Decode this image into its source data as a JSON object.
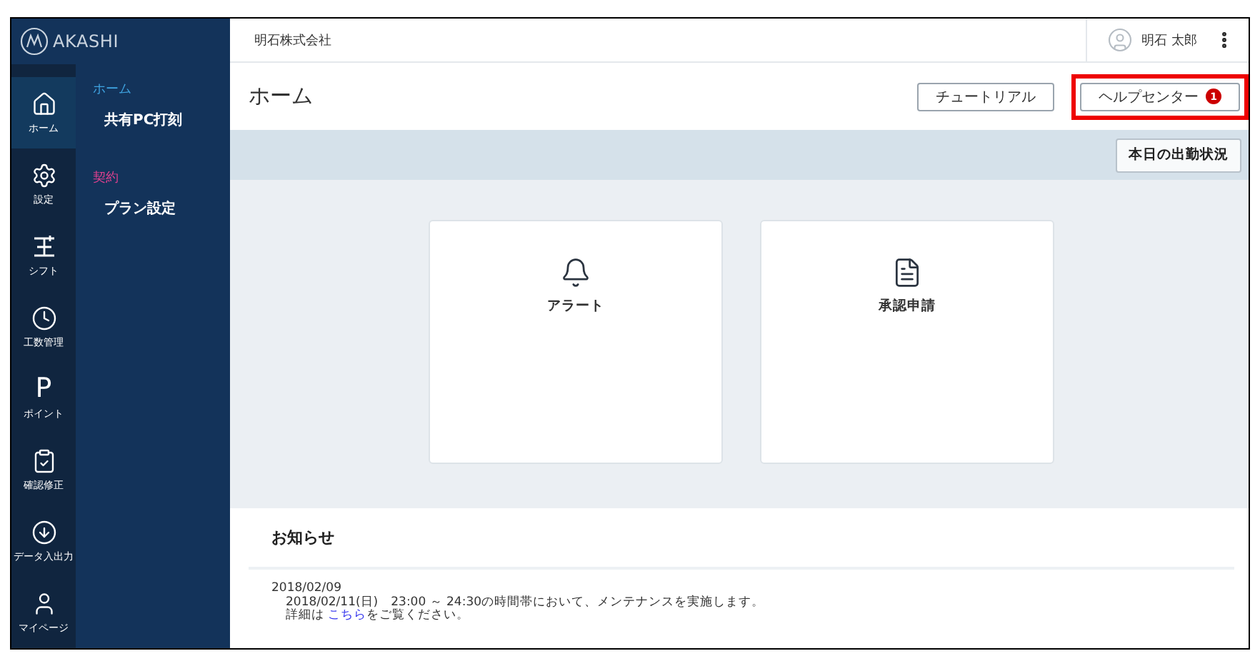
{
  "brand": {
    "name": "AKASHI"
  },
  "rail": [
    {
      "label": "ホーム",
      "selected": true
    },
    {
      "label": "設定",
      "selected": false
    },
    {
      "label": "シフト",
      "selected": false
    },
    {
      "label": "工数管理",
      "selected": false
    },
    {
      "label": "ポイント",
      "glyph": "P",
      "selected": false
    },
    {
      "label": "確認修正",
      "selected": false
    },
    {
      "label": "データ入出力",
      "selected": false
    },
    {
      "label": "マイページ",
      "selected": false
    }
  ],
  "submenu": [
    {
      "heading": "ホーム",
      "color": "#3fa3e0",
      "items": [
        "共有PC打刻"
      ]
    },
    {
      "heading": "契約",
      "color": "#e0408f",
      "items": [
        "プラン設定"
      ]
    }
  ],
  "topbar": {
    "company": "明石株式会社",
    "user": "明石 太郎"
  },
  "page": {
    "title": "ホーム",
    "buttons": [
      {
        "label": "チュートリアル",
        "highlighted": false
      },
      {
        "label": "ヘルプセンター",
        "badge": "1",
        "highlighted": true
      }
    ]
  },
  "attendance_button": "本日の出勤状況",
  "cards": [
    {
      "label": "アラート"
    },
    {
      "label": "承認申請"
    }
  ],
  "notices": {
    "title": "お知らせ",
    "items": [
      {
        "date": "2018/02/09",
        "text": "2018/02/11(日)　23:00 ～ 24:30の時間帯において、メンテナンスを実施します。",
        "detail_prefix": "詳細は ",
        "link": "こちら",
        "detail_suffix": "をご覧ください。"
      }
    ]
  }
}
